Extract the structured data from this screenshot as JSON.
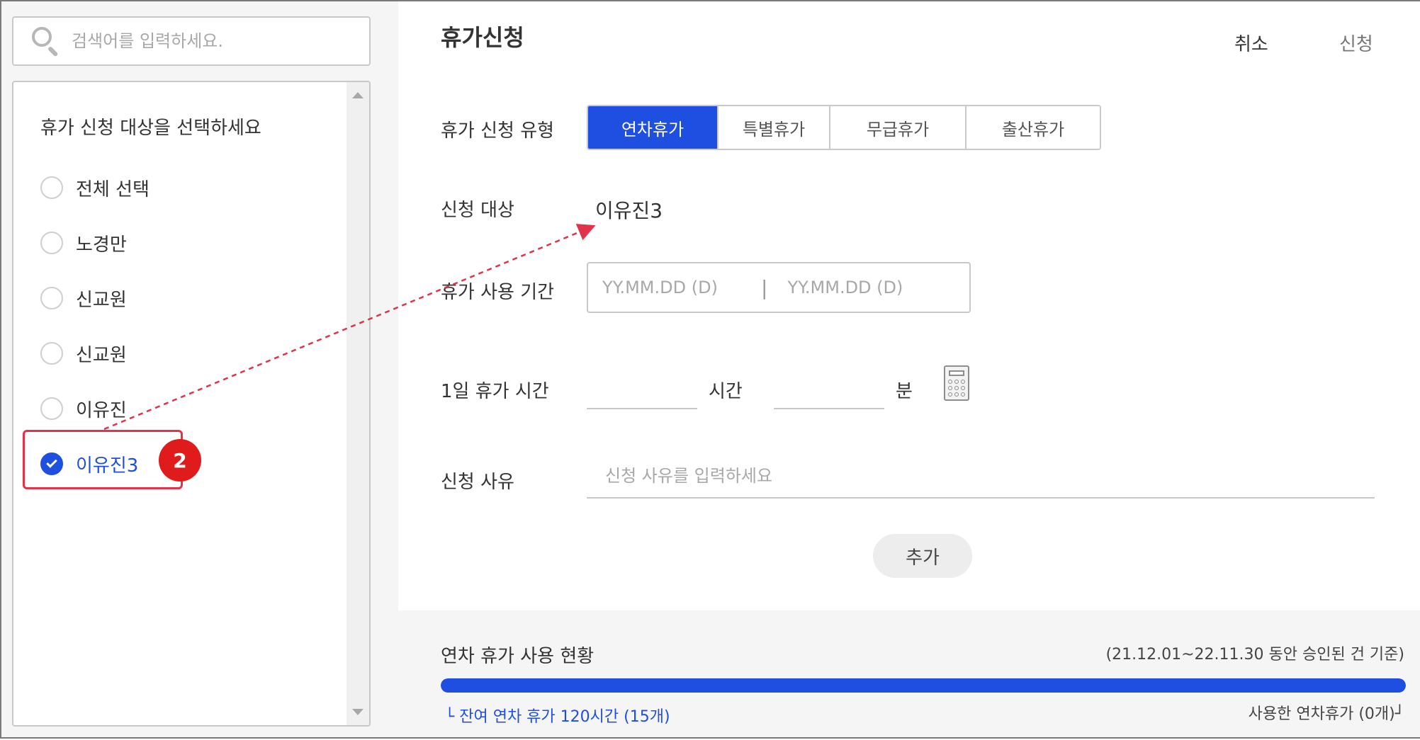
{
  "search": {
    "placeholder": "검색어를 입력하세요."
  },
  "target_panel": {
    "title": "휴가 신청 대상을 선택하세요",
    "items": [
      {
        "label": "전체 선택",
        "checked": false
      },
      {
        "label": "노경만",
        "checked": false
      },
      {
        "label": "신교원",
        "checked": false
      },
      {
        "label": "신교원",
        "checked": false
      },
      {
        "label": "이유진",
        "checked": false
      },
      {
        "label": "이유진3",
        "checked": true
      }
    ],
    "annotation_badge": "2"
  },
  "header": {
    "title": "휴가신청",
    "cancel_label": "취소",
    "apply_label": "신청"
  },
  "form": {
    "type_label": "휴가 신청 유형",
    "type_tabs": [
      {
        "label": "연차휴가",
        "active": true
      },
      {
        "label": "특별휴가",
        "active": false
      },
      {
        "label": "무급휴가",
        "active": false
      },
      {
        "label": "출산휴가",
        "active": false
      }
    ],
    "target_label": "신청 대상",
    "target_value": "이유진3",
    "period_label": "휴가 사용 기간",
    "period_start_placeholder": "YY.MM.DD (D)",
    "period_separator": "|",
    "period_end_placeholder": "YY.MM.DD (D)",
    "daily_hours_label": "1일 휴가 시간",
    "hours_unit": "시간",
    "minutes_unit": "분",
    "reason_label": "신청 사유",
    "reason_placeholder": "신청 사유를 입력하세요",
    "add_label": "추가"
  },
  "usage": {
    "title": "연차 휴가 사용 현황",
    "period_note": "(21.12.01~22.11.30 동안 승인된 건 기준)",
    "remaining_fraction": 1.0,
    "remaining_text": "└ 잔여 연차 휴가 120시간 (15개)",
    "used_text": "사용한 연차휴가 (0개)┘"
  },
  "colors": {
    "accent": "#1f4fe0",
    "annotation_red": "#e2334a",
    "badge_red": "#e01b1b"
  }
}
